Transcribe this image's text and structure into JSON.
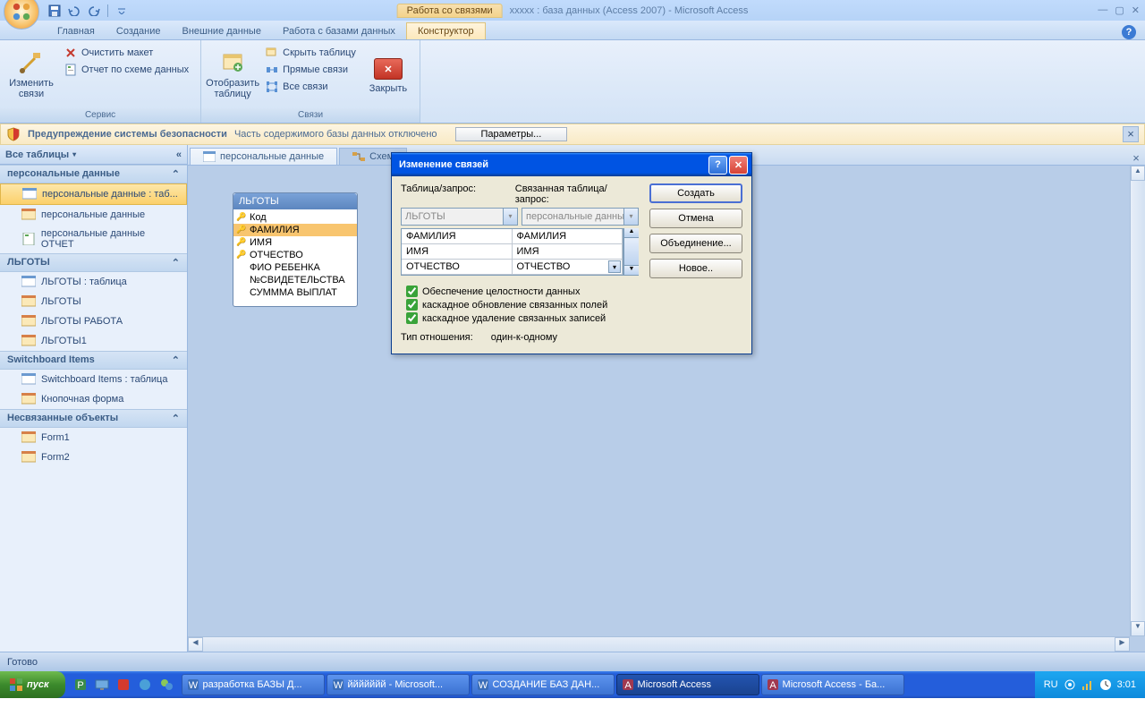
{
  "title": {
    "ctx_header": "Работа со связями",
    "app": "ххххх : база данных (Access 2007) - Microsoft Access"
  },
  "tabs": {
    "home": "Главная",
    "create": "Создание",
    "external": "Внешние данные",
    "dbtools": "Работа с базами данных",
    "ctx": "Конструктор"
  },
  "ribbon": {
    "g1": {
      "label": "Сервис",
      "edit": "Изменить связи",
      "clear": "Очистить макет",
      "report": "Отчет по схеме данных"
    },
    "g2": {
      "label": "Связи",
      "show": "Отобразить таблицу",
      "hide": "Скрыть таблицу",
      "direct": "Прямые связи",
      "all": "Все связи",
      "close": "Закрыть"
    }
  },
  "security": {
    "title": "Предупреждение системы безопасности",
    "msg": "Часть содержимого базы данных отключено",
    "btn": "Параметры..."
  },
  "nav": {
    "header": "Все таблицы",
    "g1": {
      "title": "персональные данные",
      "items": [
        "персональные данные : таб...",
        "персональные данные",
        "персональные данные ОТЧЕТ"
      ]
    },
    "g2": {
      "title": "ЛЬГОТЫ",
      "items": [
        "ЛЬГОТЫ : таблица",
        "ЛЬГОТЫ",
        "ЛЬГОТЫ РАБОТА",
        "ЛЬГОТЫ1"
      ]
    },
    "g3": {
      "title": "Switchboard Items",
      "items": [
        "Switchboard Items : таблица",
        "Кнопочная форма"
      ]
    },
    "g4": {
      "title": "Несвязанные объекты",
      "items": [
        "Form1",
        "Form2"
      ]
    }
  },
  "docs": {
    "tab1": "персональные данные",
    "tab2": "Схем"
  },
  "table_box": {
    "title": "ЛЬГОТЫ",
    "fields": [
      "Код",
      "ФАМИЛИЯ",
      "ИМЯ",
      "ОТЧЕСТВО",
      "ФИО РЕБЕНКА",
      "№СВИДЕТЕЛЬСТВА",
      "СУМММА ВЫПЛАТ"
    ],
    "keys": [
      0,
      1,
      2,
      3
    ]
  },
  "dialog": {
    "title": "Изменение связей",
    "lbl_table": "Таблица/запрос:",
    "lbl_related": "Связанная таблица/запрос:",
    "combo1": "ЛЬГОТЫ",
    "combo2": "персональные данные",
    "rows": [
      [
        "ФАМИЛИЯ",
        "ФАМИЛИЯ"
      ],
      [
        "ИМЯ",
        "ИМЯ"
      ],
      [
        "ОТЧЕСТВО",
        "ОТЧЕСТВО"
      ]
    ],
    "chk1": "Обеспечение целостности данных",
    "chk2": "каскадное обновление связанных полей",
    "chk3": "каскадное удаление связанных записей",
    "reltype_lbl": "Тип отношения:",
    "reltype_val": "один-к-одному",
    "btn_create": "Создать",
    "btn_cancel": "Отмена",
    "btn_join": "Объединение...",
    "btn_new": "Новое.."
  },
  "status": "Готово",
  "taskbar": {
    "start": "пуск",
    "tasks": [
      "разработка БАЗЫ Д...",
      "ййййййй - Microsoft...",
      "СОЗДАНИЕ БАЗ ДАН...",
      "Microsoft Access",
      "Microsoft Access - Ба..."
    ],
    "lang": "RU",
    "time": "3:01"
  }
}
